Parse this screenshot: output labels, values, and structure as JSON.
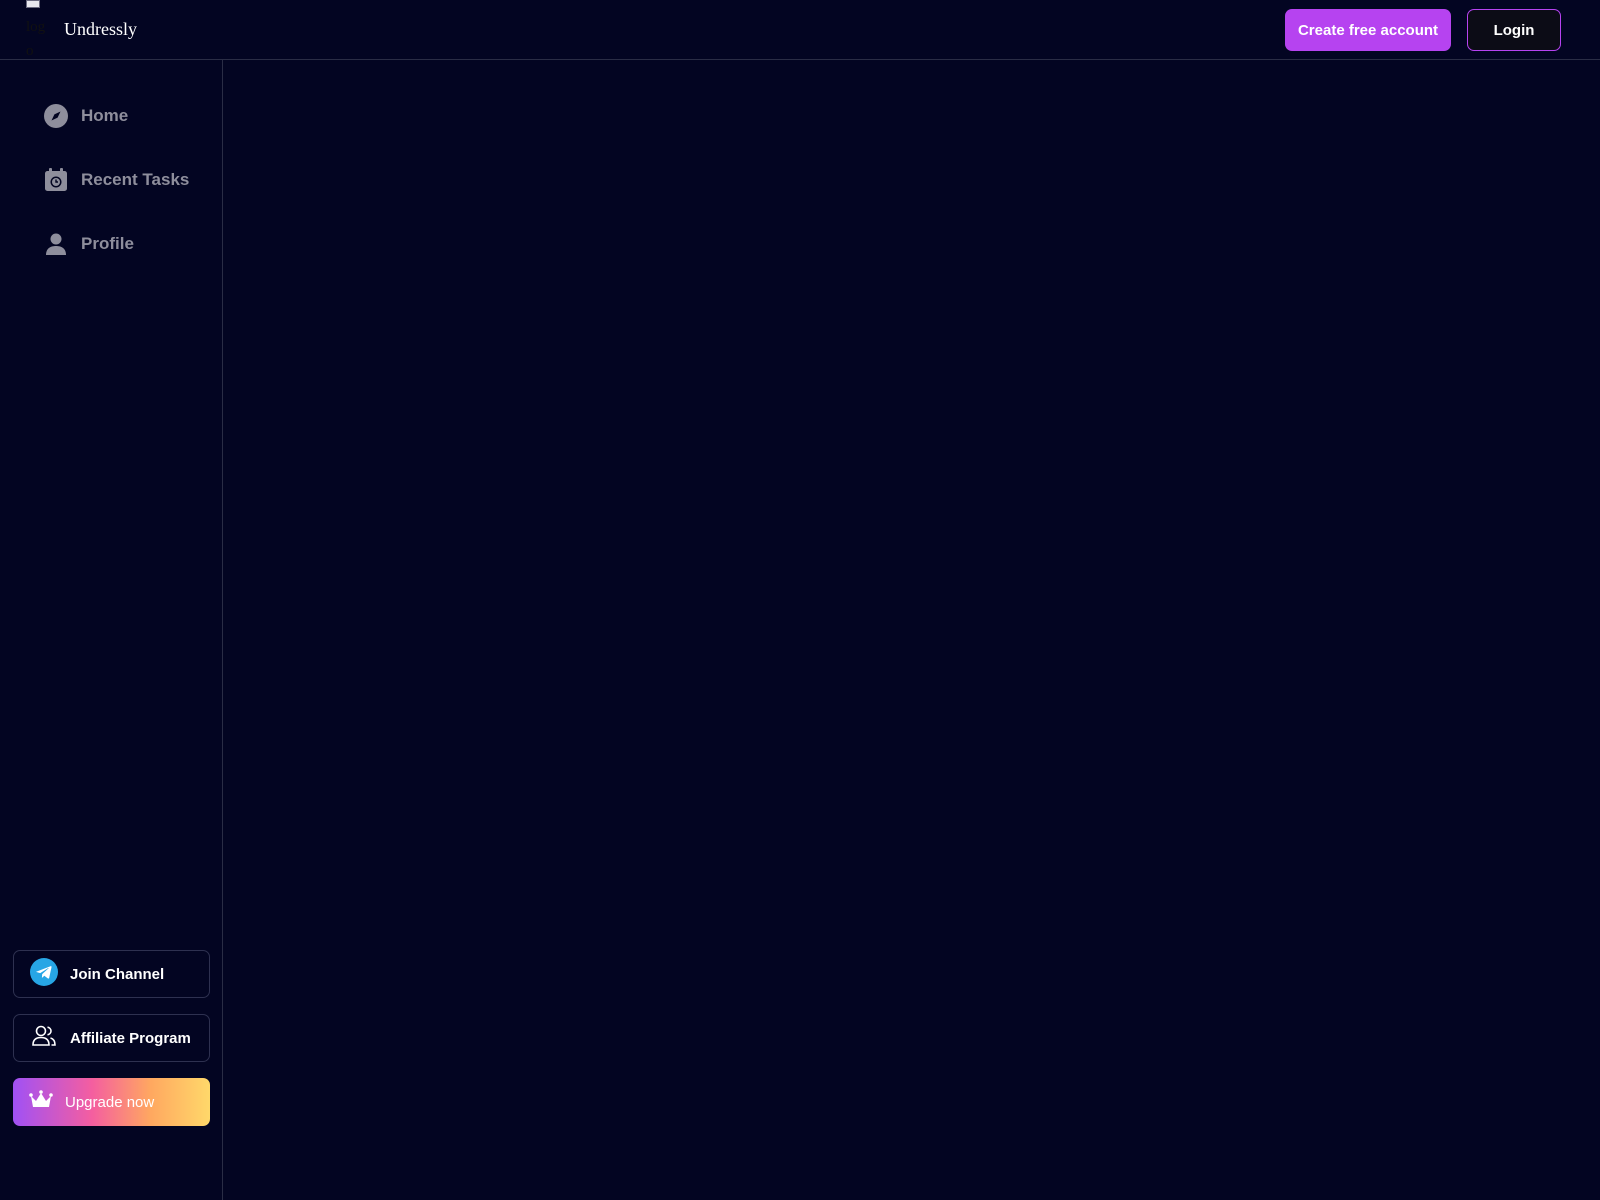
{
  "header": {
    "logo_alt": "logo",
    "brand": "Undressly",
    "create_account_label": "Create free account",
    "login_label": "Login"
  },
  "sidebar": {
    "nav": [
      {
        "label": "Home",
        "icon": "compass-icon"
      },
      {
        "label": "Recent Tasks",
        "icon": "calendar-clock-icon"
      },
      {
        "label": "Profile",
        "icon": "user-icon"
      }
    ],
    "join_channel_label": "Join Channel",
    "affiliate_label": "Affiliate Program",
    "upgrade_label": "Upgrade now"
  },
  "colors": {
    "background": "#030522",
    "accent": "#b643f0",
    "nav_text": "#8e8e9c"
  }
}
